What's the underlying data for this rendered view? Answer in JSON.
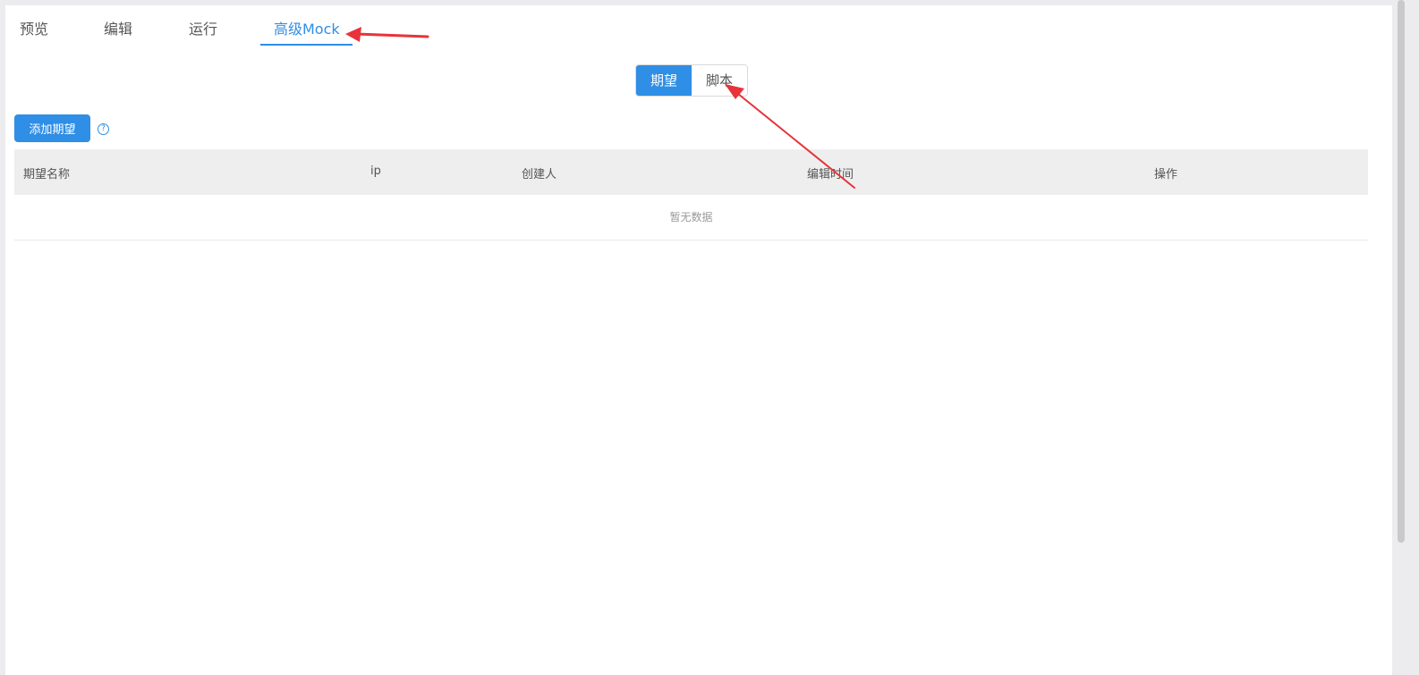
{
  "tabs": [
    {
      "label": "预览",
      "active": false
    },
    {
      "label": "编辑",
      "active": false
    },
    {
      "label": "运行",
      "active": false
    },
    {
      "label": "高级Mock",
      "active": true
    }
  ],
  "mode_switch": {
    "options": [
      {
        "label": "期望",
        "active": true
      },
      {
        "label": "脚本",
        "active": false
      }
    ]
  },
  "toolbar": {
    "add_label": "添加期望",
    "help_glyph": "?"
  },
  "table": {
    "columns": [
      "期望名称",
      "ip",
      "创建人",
      "编辑时间",
      "操作"
    ],
    "empty_text": "暂无数据"
  },
  "colors": {
    "accent": "#2f8ee5",
    "annotation": "#e8333a"
  }
}
